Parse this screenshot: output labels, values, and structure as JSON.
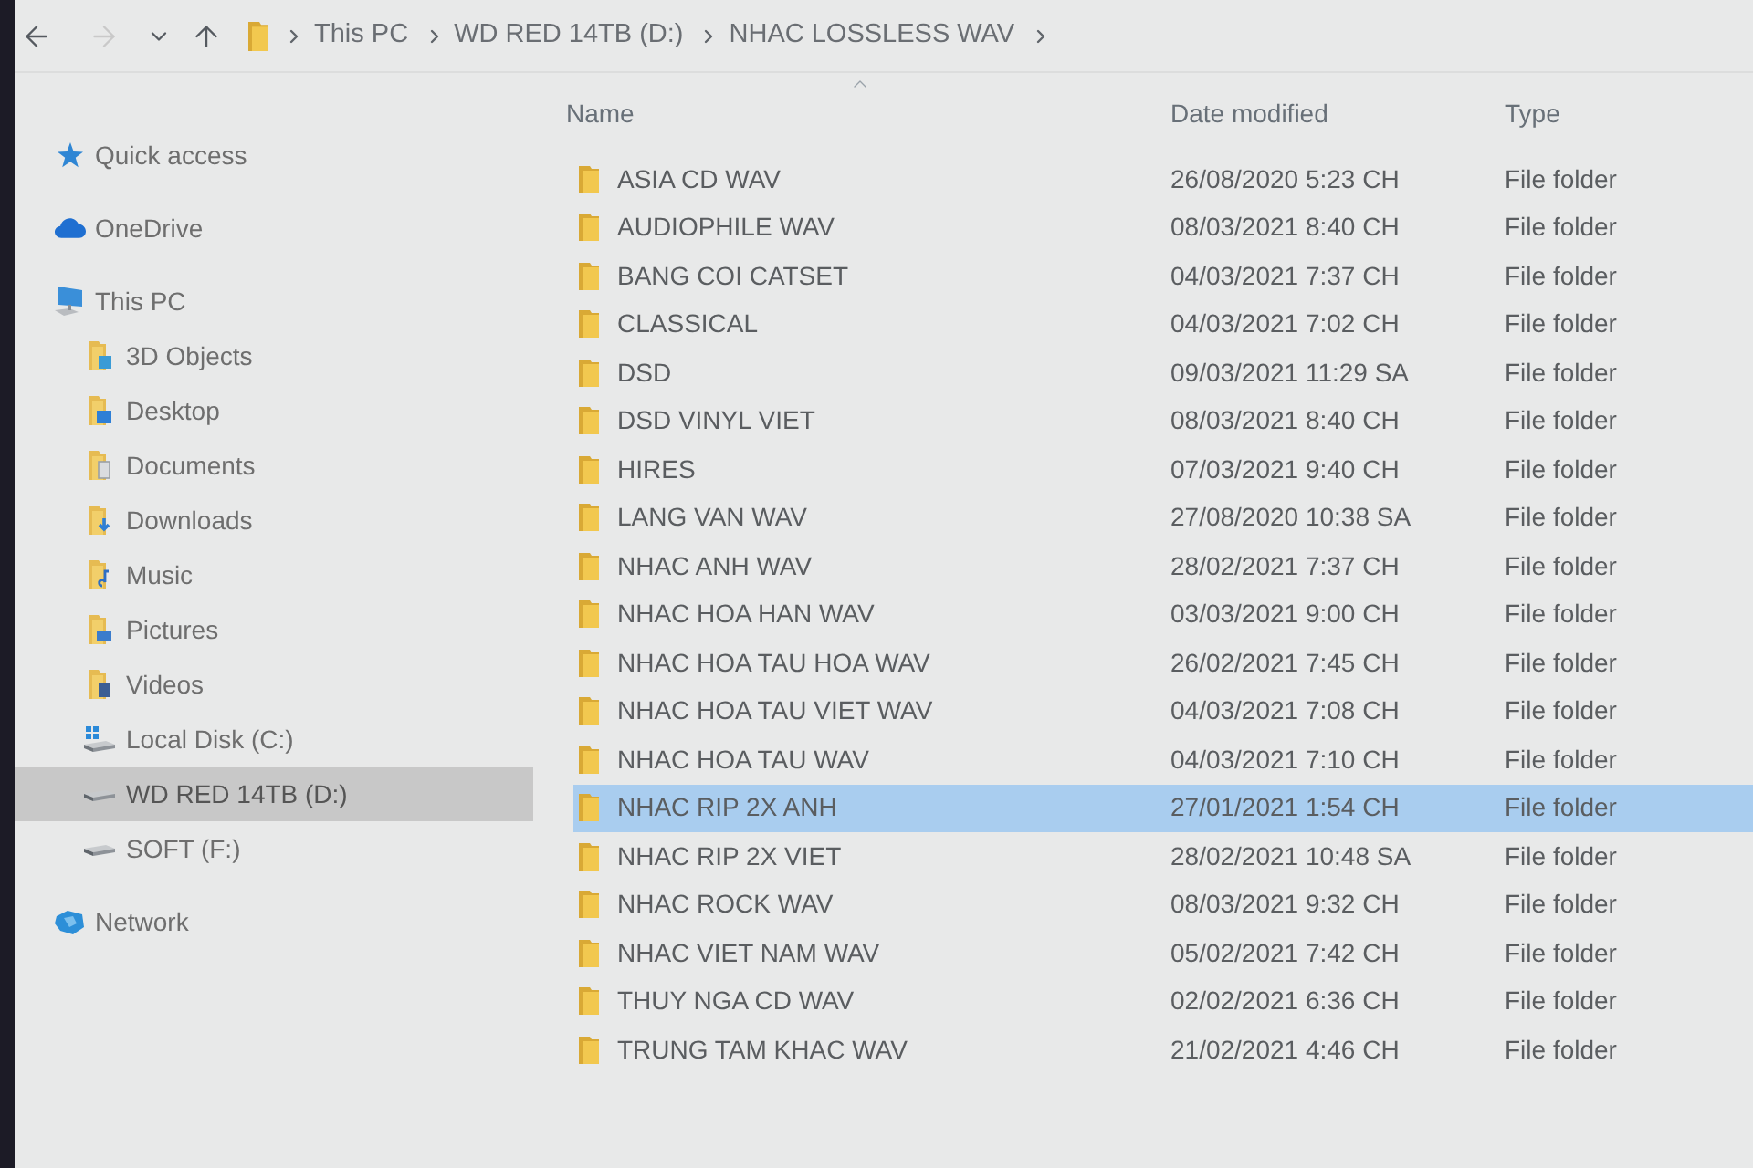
{
  "toolbar": {
    "nav_buttons": [
      {
        "kind": "back",
        "disabled": false
      },
      {
        "kind": "forward",
        "disabled": true
      },
      {
        "kind": "recent",
        "disabled": false
      },
      {
        "kind": "up",
        "disabled": false
      }
    ]
  },
  "address_bar": {
    "path": [
      "This PC",
      "WD RED 14TB (D:)",
      "NHAC LOSSLESS WAV"
    ]
  },
  "sidebar": {
    "items": [
      {
        "label": "Quick access",
        "kind": "star",
        "selected": false
      },
      {
        "label": "OneDrive",
        "kind": "cloud",
        "selected": false
      },
      {
        "label": "This PC",
        "kind": "pc",
        "selected": false,
        "children": [
          {
            "label": "3D Objects",
            "kind": "objects",
            "selected": false
          },
          {
            "label": "Desktop",
            "kind": "desktop",
            "selected": false
          },
          {
            "label": "Documents",
            "kind": "documents",
            "selected": false
          },
          {
            "label": "Downloads",
            "kind": "downloads",
            "selected": false
          },
          {
            "label": "Music",
            "kind": "music",
            "selected": false
          },
          {
            "label": "Pictures",
            "kind": "pictures",
            "selected": false
          },
          {
            "label": "Videos",
            "kind": "videos",
            "selected": false
          },
          {
            "label": "Local Disk (C:)",
            "kind": "system_disk",
            "selected": false
          },
          {
            "label": "WD RED 14TB (D:)",
            "kind": "drive",
            "selected": true
          },
          {
            "label": "SOFT (F:)",
            "kind": "drive",
            "selected": false
          }
        ]
      },
      {
        "label": "Network",
        "kind": "network",
        "selected": false
      }
    ]
  },
  "file_list": {
    "columns": [
      {
        "label": "Name",
        "sorted": true
      },
      {
        "label": "Date modified",
        "sorted": false
      },
      {
        "label": "Type",
        "sorted": false
      }
    ],
    "rows": [
      {
        "name": "ASIA CD WAV",
        "date_modified": "26/08/2020 5:23 CH",
        "type": "File folder",
        "selected": false
      },
      {
        "name": "AUDIOPHILE WAV",
        "date_modified": "08/03/2021 8:40 CH",
        "type": "File folder",
        "selected": false
      },
      {
        "name": "BANG COI CATSET",
        "date_modified": "04/03/2021 7:37 CH",
        "type": "File folder",
        "selected": false
      },
      {
        "name": "CLASSICAL",
        "date_modified": "04/03/2021 7:02 CH",
        "type": "File folder",
        "selected": false
      },
      {
        "name": "DSD",
        "date_modified": "09/03/2021 11:29 SA",
        "type": "File folder",
        "selected": false
      },
      {
        "name": "DSD VINYL VIET",
        "date_modified": "08/03/2021 8:40 CH",
        "type": "File folder",
        "selected": false
      },
      {
        "name": "HIRES",
        "date_modified": "07/03/2021 9:40 CH",
        "type": "File folder",
        "selected": false
      },
      {
        "name": "LANG VAN WAV",
        "date_modified": "27/08/2020 10:38 SA",
        "type": "File folder",
        "selected": false
      },
      {
        "name": "NHAC ANH WAV",
        "date_modified": "28/02/2021 7:37 CH",
        "type": "File folder",
        "selected": false
      },
      {
        "name": "NHAC HOA HAN WAV",
        "date_modified": "03/03/2021 9:00 CH",
        "type": "File folder",
        "selected": false
      },
      {
        "name": "NHAC HOA TAU HOA WAV",
        "date_modified": "26/02/2021 7:45 CH",
        "type": "File folder",
        "selected": false
      },
      {
        "name": "NHAC HOA TAU VIET WAV",
        "date_modified": "04/03/2021 7:08 CH",
        "type": "File folder",
        "selected": false
      },
      {
        "name": "NHAC HOA TAU WAV",
        "date_modified": "04/03/2021 7:10 CH",
        "type": "File folder",
        "selected": false
      },
      {
        "name": "NHAC RIP 2X ANH",
        "date_modified": "27/01/2021 1:54 CH",
        "type": "File folder",
        "selected": true
      },
      {
        "name": "NHAC RIP 2X VIET",
        "date_modified": "28/02/2021 10:48 SA",
        "type": "File folder",
        "selected": false
      },
      {
        "name": "NHAC ROCK WAV",
        "date_modified": "08/03/2021 9:32 CH",
        "type": "File folder",
        "selected": false
      },
      {
        "name": "NHAC VIET NAM WAV",
        "date_modified": "05/02/2021 7:42 CH",
        "type": "File folder",
        "selected": false
      },
      {
        "name": "THUY NGA CD WAV",
        "date_modified": "02/02/2021 6:36 CH",
        "type": "File folder",
        "selected": false
      },
      {
        "name": "TRUNG TAM KHAC WAV",
        "date_modified": "21/02/2021 4:46 CH",
        "type": "File folder",
        "selected": false
      }
    ]
  }
}
